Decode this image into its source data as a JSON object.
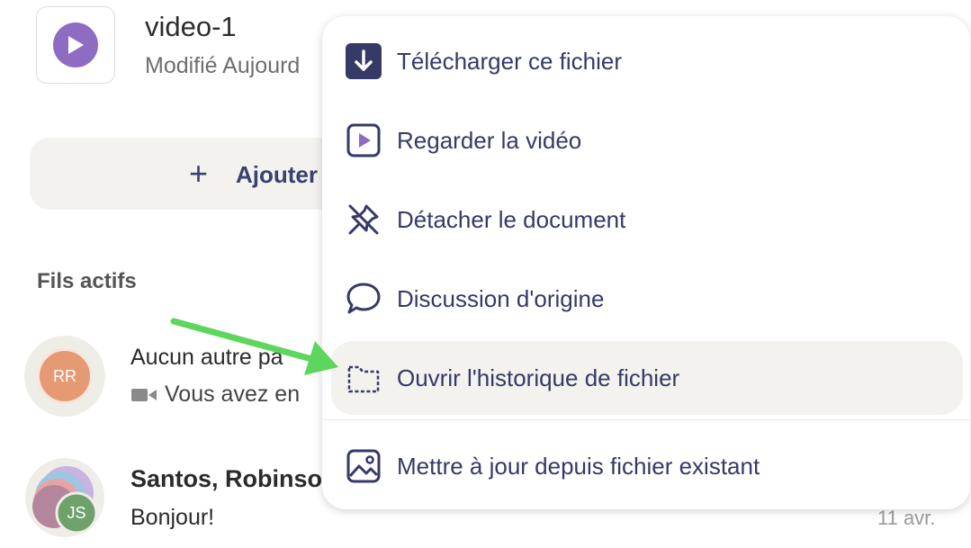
{
  "file": {
    "name": "video-1",
    "meta": "Modifié Aujourd"
  },
  "add_button": {
    "label": "Ajouter"
  },
  "section": {
    "title": "Fils actifs"
  },
  "threads": [
    {
      "initials": "RR",
      "title": "Aucun autre pa",
      "subtitle": "Vous avez en"
    },
    {
      "initials": "JS",
      "title": "Santos, Robinso",
      "subtitle": "Bonjour!",
      "date": "11 avr."
    }
  ],
  "menu": {
    "items": [
      {
        "label": "Télécharger ce fichier",
        "icon": "download-icon"
      },
      {
        "label": "Regarder la vidéo",
        "icon": "play-icon"
      },
      {
        "label": "Détacher le document",
        "icon": "unpin-icon"
      },
      {
        "label": "Discussion d'origine",
        "icon": "chat-bubble-icon"
      },
      {
        "label": "Ouvrir l'historique de fichier",
        "icon": "folder-icon",
        "highlighted": true
      },
      {
        "label": "Mettre à jour depuis fichier existant",
        "icon": "image-icon"
      }
    ]
  },
  "colors": {
    "accent": "#353a66",
    "play": "#8e6cc2",
    "arrow": "#5cd65c"
  }
}
